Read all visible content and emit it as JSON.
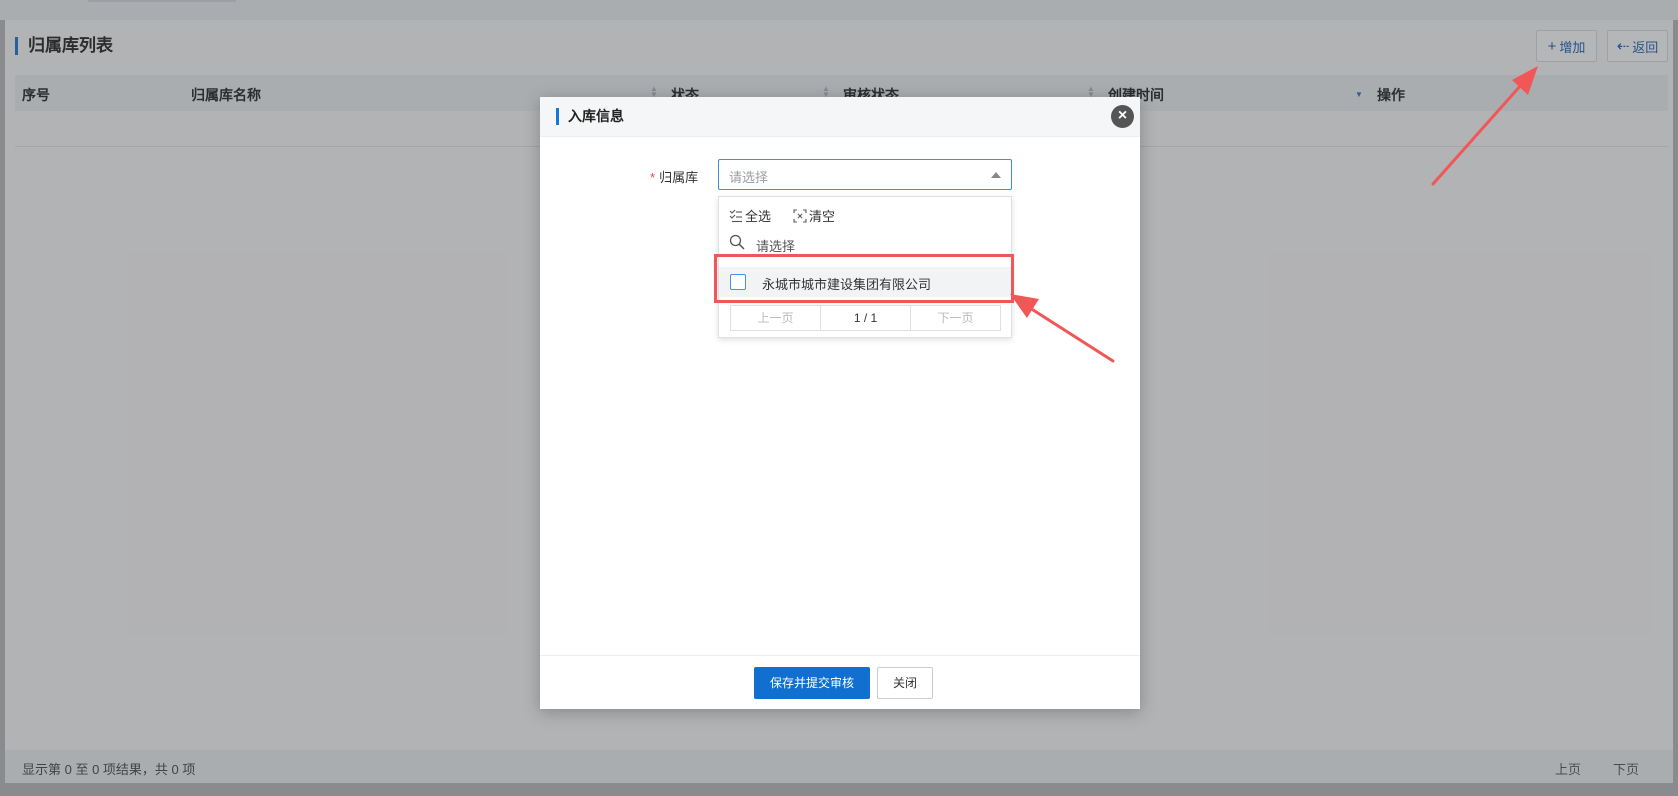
{
  "page": {
    "title": "归属库列表",
    "add_label": "增加",
    "back_label": "返回"
  },
  "table": {
    "columns": [
      "序号",
      "归属库名称",
      "状态",
      "审核状态",
      "创建时间",
      "操作"
    ]
  },
  "footer": {
    "info": "显示第 0 至 0 项结果，共 0 项",
    "prev": "上页",
    "next": "下页"
  },
  "modal": {
    "title": "入库信息",
    "field_label": "归属库",
    "required_mark": "*",
    "select_placeholder": "请选择",
    "dropdown": {
      "select_all": "全选",
      "clear": "清空",
      "search_placeholder": "请选择",
      "items": [
        "永城市城市建设集团有限公司"
      ],
      "pager": {
        "prev": "上一页",
        "page": "1 / 1",
        "next": "下一页"
      }
    },
    "submit_label": "保存并提交审核",
    "close_label": "关闭"
  },
  "colors": {
    "accent": "#1170cf",
    "annotation": "#f25757"
  }
}
